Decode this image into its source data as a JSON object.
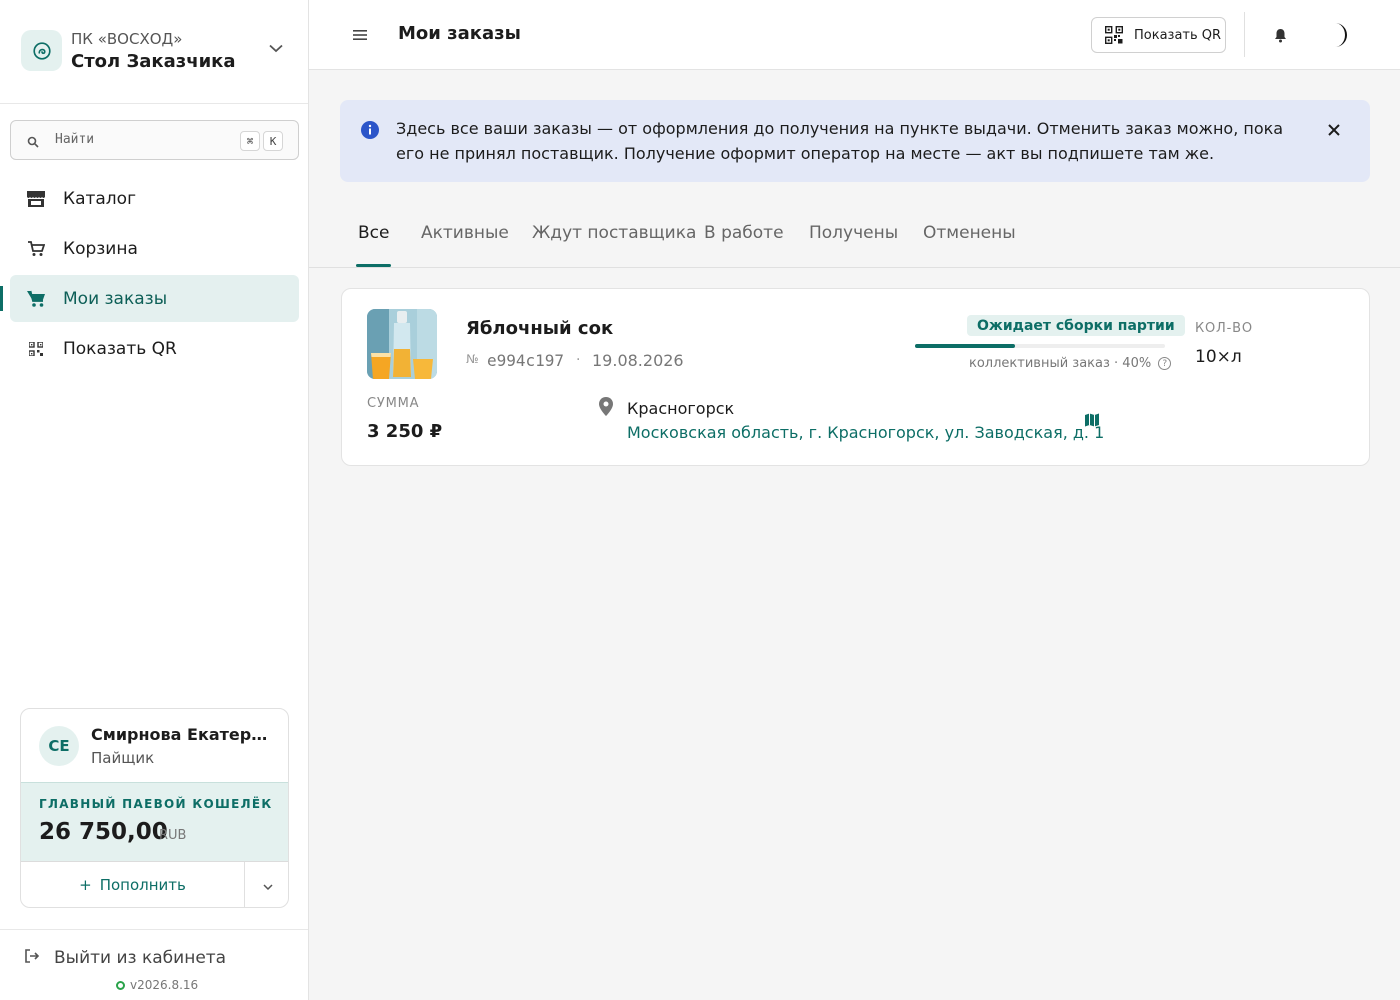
{
  "brand": {
    "org": "ПК «ВОСХОД»",
    "name": "Стол Заказчика"
  },
  "search": {
    "placeholder": "Найти",
    "kbd1": "⌘",
    "kbd2": "K"
  },
  "nav": {
    "items": [
      {
        "label": "Каталог",
        "icon": "store-icon"
      },
      {
        "label": "Корзина",
        "icon": "cart-icon"
      },
      {
        "label": "Мои заказы",
        "icon": "cart-filled-icon",
        "active": true
      },
      {
        "label": "Показать QR",
        "icon": "qr-icon"
      }
    ]
  },
  "user": {
    "initials": "СЕ",
    "name": "Смирнова Екатерина",
    "role": "Пайщик"
  },
  "wallet": {
    "title": "ГЛАВНЫЙ ПАЕВОЙ КОШЕЛЁК",
    "amount": "26 750,00",
    "currency": "RUB",
    "topup_label": "Пополнить"
  },
  "footer": {
    "logout_label": "Выйти из кабинета",
    "version": "v2026.8.16"
  },
  "header": {
    "title": "Мои заказы",
    "qr_label": "Показать QR"
  },
  "info": {
    "text": "Здесь все ваши заказы — от оформления до получения на пункте выдачи. Отменить заказ можно, пока его не принял поставщик. Получение оформит оператор на месте — акт вы подпишете там же."
  },
  "tabs": [
    {
      "label": "Все",
      "active": true
    },
    {
      "label": "Активные"
    },
    {
      "label": "Ждут поставщика"
    },
    {
      "label": "В работе"
    },
    {
      "label": "Получены"
    },
    {
      "label": "Отменены"
    }
  ],
  "order": {
    "title": "Яблочный сок",
    "number_sign": "№",
    "number": "e994c197",
    "date": "19.08.2026",
    "status": "Ожидает сборки партии",
    "progress_percent": 40,
    "progress_note": "коллективный заказ · 40%",
    "qty_label": "КОЛ-ВО",
    "qty_value": "10×л",
    "sum_label": "СУММА",
    "sum_value": "3 250 ₽",
    "city": "Красногорск",
    "address": "Московская область, г. Красногорск, ул. Заводская, д. 1"
  },
  "colors": {
    "accent": "#0d6e66",
    "accent_bg": "#e4f1ef",
    "info_bg": "#e3e8f7",
    "info_icon": "#2c55c9"
  }
}
